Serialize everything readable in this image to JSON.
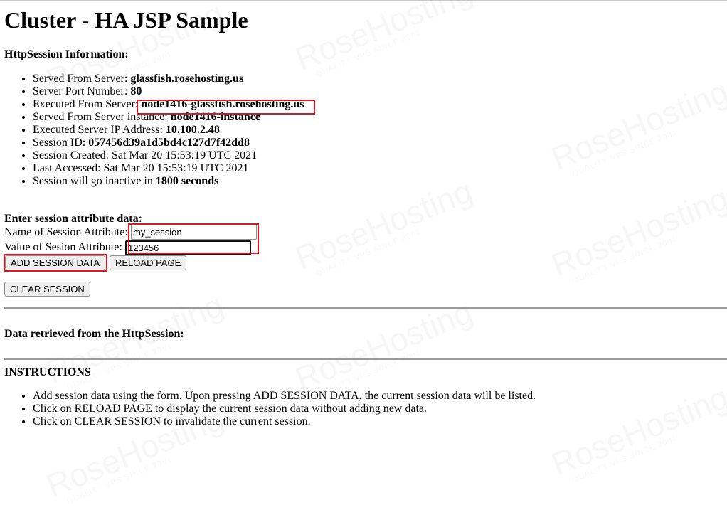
{
  "page": {
    "title": "Cluster - HA JSP Sample",
    "session_info_heading": "HttpSession Information:",
    "session_info": [
      {
        "label": "Served From Server: ",
        "value": "glassfish.rosehosting.us"
      },
      {
        "label": "Server Port Number: ",
        "value": "80"
      },
      {
        "label": "Executed From Server: ",
        "value": "node1416-glassfish.rosehosting.us"
      },
      {
        "label": "Served From Server instance: ",
        "value": "node1416-instance"
      },
      {
        "label": "Executed Server IP Address: ",
        "value": "10.100.2.48"
      },
      {
        "label": "Session ID: ",
        "value": "057456d39a1d5bd4c127d7f42dd8"
      },
      {
        "label": "Session Created: Sat Mar 20 15:53:19 UTC 2021",
        "value": ""
      },
      {
        "label": "Last Accessed: Sat Mar 20 15:53:19 UTC 2021",
        "value": ""
      },
      {
        "label": "Session will go inactive in ",
        "value": "1800 seconds"
      }
    ],
    "form": {
      "heading": "Enter session attribute data:",
      "name_label": "Name of Session Attribute:",
      "name_value": "my_session",
      "value_label": "Value of Sesion Attribute:",
      "value_value": "123456",
      "add_button": "ADD SESSION DATA",
      "reload_button": "RELOAD PAGE",
      "clear_button": "CLEAR SESSION"
    },
    "retrieved_heading": "Data retrieved from the HttpSession:",
    "instructions_heading": "INSTRUCTIONS",
    "instructions": [
      "Add session data using the form. Upon pressing ADD SESSION DATA, the current session data will be listed.",
      "Click on RELOAD PAGE to display the current session data without adding new data.",
      "Click on CLEAR SESSION to invalidate the current session."
    ],
    "watermark": {
      "brand": "RoseHosting",
      "tagline": "QUALITY VPS SINCE 2001"
    },
    "highlight_color": "#e0141e"
  }
}
